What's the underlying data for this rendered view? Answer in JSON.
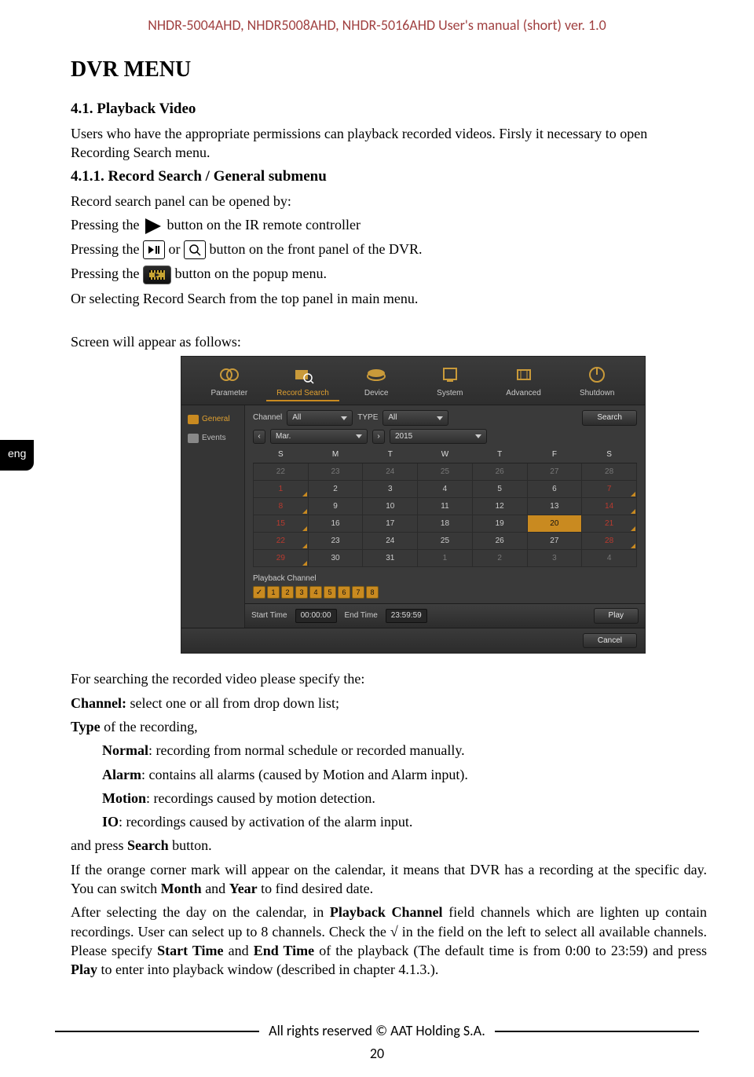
{
  "header": "NHDR-5004AHD, NHDR5008AHD, NHDR-5016AHD User's manual (short) ver. 1.0",
  "page_title": "DVR MENU",
  "tab_lang": "eng",
  "s41": {
    "heading": "4.1. Playback Video",
    "p1": "Users who have the appropriate permissions can playback recorded videos. Firsly it necessary to open Recording Search menu."
  },
  "s411": {
    "heading": "4.1.1. Record Search / General submenu",
    "p_open": "Record search panel can be opened by:",
    "p_ir_a": "Pressing the ",
    "p_ir_b": " button on the IR remote controller",
    "p_fp_a": "Pressing the ",
    "p_fp_or": " or ",
    "p_fp_b": " button on the front panel of the DVR.",
    "p_pop_a": "Pressing the ",
    "p_pop_b": " button on the popup menu.",
    "p_top": "Or selecting Record Search from the top panel in main menu.",
    "p_appear": "Screen will appear as follows:"
  },
  "dvr": {
    "tabs": [
      "Parameter",
      "Record Search",
      "Device",
      "System",
      "Advanced",
      "Shutdown"
    ],
    "side": {
      "general": "General",
      "events": "Events"
    },
    "labels": {
      "channel": "Channel",
      "type": "TYPE",
      "search": "Search",
      "month": "Mar.",
      "year": "2015",
      "playback_ch": "Playback Channel",
      "start": "Start Time",
      "end": "End Time",
      "play": "Play",
      "cancel": "Cancel",
      "all": "All"
    },
    "time": {
      "start": "00:00:00",
      "end": "23:59:59"
    },
    "days": [
      "S",
      "M",
      "T",
      "W",
      "T",
      "F",
      "S"
    ],
    "cal": [
      [
        {
          "v": "22",
          "dim": true
        },
        {
          "v": "23",
          "dim": true
        },
        {
          "v": "24",
          "dim": true
        },
        {
          "v": "25",
          "dim": true
        },
        {
          "v": "26",
          "dim": true
        },
        {
          "v": "27",
          "dim": true
        },
        {
          "v": "28",
          "dim": true
        }
      ],
      [
        {
          "v": "1",
          "rec": true
        },
        {
          "v": "2"
        },
        {
          "v": "3"
        },
        {
          "v": "4"
        },
        {
          "v": "5"
        },
        {
          "v": "6"
        },
        {
          "v": "7",
          "rec": true
        }
      ],
      [
        {
          "v": "8",
          "rec": true
        },
        {
          "v": "9"
        },
        {
          "v": "10"
        },
        {
          "v": "11"
        },
        {
          "v": "12"
        },
        {
          "v": "13"
        },
        {
          "v": "14",
          "rec": true
        }
      ],
      [
        {
          "v": "15",
          "rec": true
        },
        {
          "v": "16"
        },
        {
          "v": "17"
        },
        {
          "v": "18"
        },
        {
          "v": "19"
        },
        {
          "v": "20",
          "sel": true
        },
        {
          "v": "21",
          "rec": true
        }
      ],
      [
        {
          "v": "22",
          "rec": true
        },
        {
          "v": "23"
        },
        {
          "v": "24"
        },
        {
          "v": "25"
        },
        {
          "v": "26"
        },
        {
          "v": "27"
        },
        {
          "v": "28",
          "rec": true
        }
      ],
      [
        {
          "v": "29",
          "rec": true
        },
        {
          "v": "30"
        },
        {
          "v": "31"
        },
        {
          "v": "1",
          "dim": true
        },
        {
          "v": "2",
          "dim": true
        },
        {
          "v": "3",
          "dim": true
        },
        {
          "v": "4",
          "dim": true
        }
      ]
    ],
    "channels": [
      "1",
      "2",
      "3",
      "4",
      "5",
      "6",
      "7",
      "8"
    ]
  },
  "below": {
    "l1": "For searching the recorded video please specify the:",
    "l2a": "Channel:",
    "l2b": " select one or all from drop down list;",
    "l3a": "Type",
    "l3b": " of the recording,",
    "n_a": "Normal",
    "n_b": ": recording from normal schedule or recorded manually.",
    "a_a": "Alarm",
    "a_b": ": contains all alarms (caused by Motion and Alarm input).",
    "m_a": "Motion",
    "m_b": ": recordings caused by motion detection.",
    "i_a": "IO",
    "i_b": ": recordings caused by activation of the alarm input.",
    "l4a": "and press ",
    "l4b": "Search",
    "l4c": " button.",
    "l5": "If the orange corner mark will appear on the calendar, it means that DVR has a recording at the specific day. You can switch ",
    "l5b": "Month",
    "l5c": " and ",
    "l5d": "Year",
    "l5e": " to find desired date.",
    "l6a": "After selecting the day on the calendar, in ",
    "l6b": "Playback Channel",
    "l6c": " field channels which are lighten up contain recordings. User can select up to 8 channels. Check the √ in the field on the left to select all available channels. Please specify ",
    "l6d": "Start Time",
    "l6e": " and ",
    "l6f": "End Time",
    "l6g": " of the playback (The default time is from 0:00 to 23:59) and press ",
    "l6h": "Play",
    "l6i": " to enter into playback window (described in chapter 4.1.3.)."
  },
  "footer": {
    "rights": "All rights reserved © AAT Holding S.A.",
    "page": "20"
  }
}
